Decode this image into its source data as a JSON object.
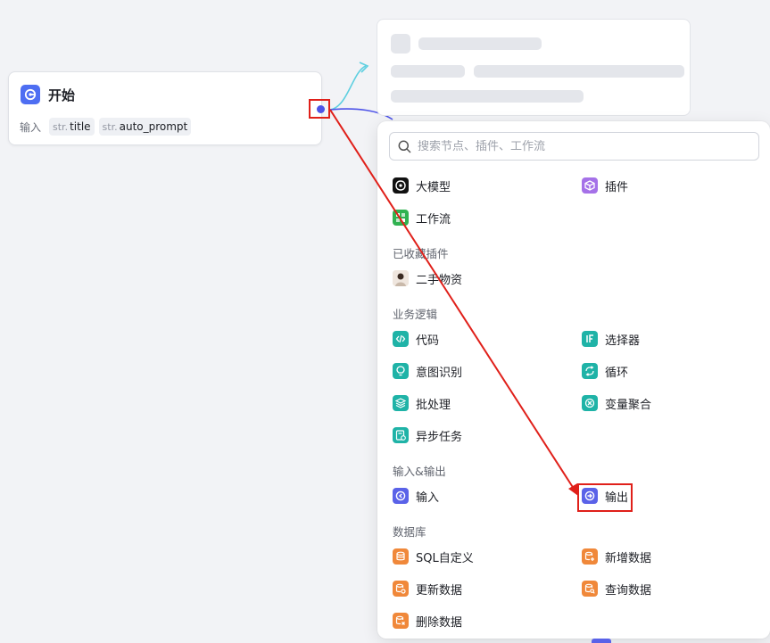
{
  "start_node": {
    "title": "开始",
    "inputs_label": "输入",
    "params": [
      {
        "type": "str.",
        "name": "title"
      },
      {
        "type": "str.",
        "name": "auto_prompt"
      }
    ]
  },
  "search": {
    "placeholder": "搜索节点、插件、工作流"
  },
  "top_items": [
    {
      "label": "大模型",
      "icon": "llm-icon"
    },
    {
      "label": "插件",
      "icon": "plugin-cube-icon"
    },
    {
      "label": "工作流",
      "icon": "workflow-icon"
    }
  ],
  "sections": {
    "favorites": {
      "title": "已收藏插件",
      "items": [
        {
          "label": "二手物资",
          "icon": "avatar-thumbnail-icon"
        }
      ]
    },
    "business_logic": {
      "title": "业务逻辑",
      "items": [
        {
          "label": "代码",
          "icon": "code-icon"
        },
        {
          "label": "选择器",
          "icon": "if-selector-icon"
        },
        {
          "label": "意图识别",
          "icon": "intent-bulb-icon"
        },
        {
          "label": "循环",
          "icon": "loop-icon"
        },
        {
          "label": "批处理",
          "icon": "batch-layers-icon"
        },
        {
          "label": "变量聚合",
          "icon": "variable-merge-icon"
        },
        {
          "label": "异步任务",
          "icon": "async-task-icon"
        }
      ]
    },
    "io": {
      "title": "输入&输出",
      "items": [
        {
          "label": "输入",
          "icon": "input-icon"
        },
        {
          "label": "输出",
          "icon": "output-icon"
        }
      ]
    },
    "database": {
      "title": "数据库",
      "items": [
        {
          "label": "SQL自定义",
          "icon": "sql-db-icon"
        },
        {
          "label": "新增数据",
          "icon": "db-add-icon"
        },
        {
          "label": "更新数据",
          "icon": "db-update-icon"
        },
        {
          "label": "查询数据",
          "icon": "db-query-icon"
        },
        {
          "label": "删除数据",
          "icon": "db-delete-icon"
        }
      ]
    }
  },
  "colors": {
    "teal": "#1fb3a7",
    "orange": "#f0883a",
    "indigo": "#5a62e8",
    "annotation_red": "#e0201a",
    "edge_cyan": "#5ecfe0",
    "edge_blue": "#4d53e8"
  }
}
